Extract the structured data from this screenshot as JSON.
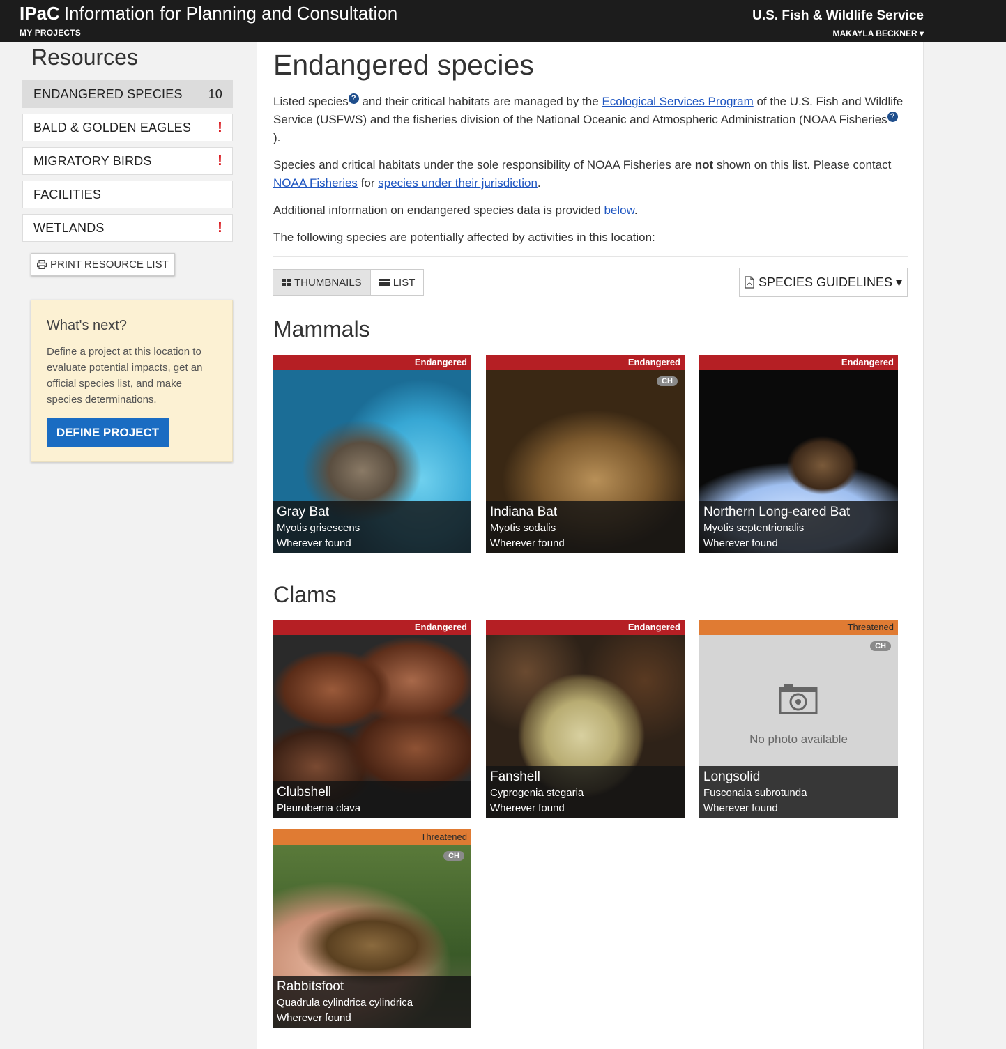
{
  "header": {
    "brand_short": "IPaC",
    "brand_title": "Information for Planning and Consultation",
    "my_projects": "MY PROJECTS",
    "agency": "U.S. Fish & Wildlife Service",
    "user": "MAKAYLA BECKNER ▾"
  },
  "sidebar": {
    "title": "Resources",
    "items": [
      {
        "label": "ENDANGERED SPECIES",
        "badge": "10"
      },
      {
        "label": "BALD & GOLDEN EAGLES",
        "badge": "!"
      },
      {
        "label": "MIGRATORY BIRDS",
        "badge": "!"
      },
      {
        "label": "FACILITIES",
        "badge": ""
      },
      {
        "label": "WETLANDS",
        "badge": "!"
      }
    ],
    "print_label": "PRINT RESOURCE LIST",
    "next": {
      "title": "What's next?",
      "text": "Define a project at this location to evaluate potential impacts, get an official species list, and make species determinations.",
      "button": "DEFINE PROJECT"
    }
  },
  "main": {
    "title": "Endangered species",
    "p1": {
      "a": "Listed species",
      "b": " and their critical habitats are managed by the ",
      "link": "Ecological Services Program",
      "c": " of the U.S. Fish and Wildlife Service (USFWS) and the fisheries division of the National Oceanic and Atmospheric Administration (NOAA Fisheries",
      "d": ")."
    },
    "p2": {
      "a": "Species and critical habitats under the sole responsibility of NOAA Fisheries are ",
      "bold": "not",
      "b": " shown on this list. Please contact ",
      "link1": "NOAA Fisheries",
      "c": " for ",
      "link2": "species under their jurisdiction",
      "d": "."
    },
    "p3": {
      "a": "Additional information on endangered species data is provided ",
      "link": "below",
      "b": "."
    },
    "p4": "The following species are potentially affected by activities in this location:",
    "view_thumbnails": "THUMBNAILS",
    "view_list": "LIST",
    "guidelines": "SPECIES GUIDELINES ▾",
    "sections": {
      "mammals": {
        "title": "Mammals",
        "species": [
          {
            "status": "Endangered",
            "name": "Gray Bat",
            "sci": "Myotis grisescens",
            "range": "Wherever found",
            "ch": ""
          },
          {
            "status": "Endangered",
            "name": "Indiana Bat",
            "sci": "Myotis sodalis",
            "range": "Wherever found",
            "ch": "CH"
          },
          {
            "status": "Endangered",
            "name": "Northern Long-eared Bat",
            "sci": "Myotis septentrionalis",
            "range": "Wherever found",
            "ch": ""
          }
        ]
      },
      "clams": {
        "title": "Clams",
        "species": [
          {
            "status": "Endangered",
            "name": "Clubshell",
            "sci": "Pleurobema clava",
            "range": "",
            "ch": ""
          },
          {
            "status": "Endangered",
            "name": "Fanshell",
            "sci": "Cyprogenia stegaria",
            "range": "Wherever found",
            "ch": ""
          },
          {
            "status": "Threatened",
            "name": "Longsolid",
            "sci": "Fusconaia subrotunda",
            "range": "Wherever found",
            "ch": "CH",
            "no_photo": "No photo available"
          },
          {
            "status": "Threatened",
            "name": "Rabbitsfoot",
            "sci": "Quadrula cylindrica cylindrica",
            "range": "Wherever found",
            "ch": "CH"
          }
        ]
      }
    }
  },
  "colors": {
    "endangered": "#b51f24",
    "threatened": "#e07b33",
    "primary_button": "#1a6cc2",
    "alert": "#d9151b"
  }
}
